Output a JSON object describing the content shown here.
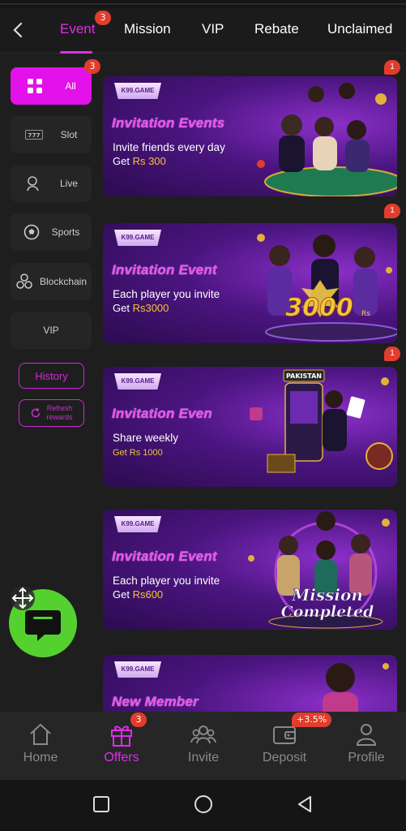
{
  "topnav": {
    "tabs": [
      {
        "label": "Event",
        "badge": "3"
      },
      {
        "label": "Mission"
      },
      {
        "label": "VIP"
      },
      {
        "label": "Rebate"
      },
      {
        "label": "Unclaimed"
      }
    ]
  },
  "sidebar": {
    "items": [
      {
        "label": "All",
        "icon": "grid-icon",
        "badge": "3"
      },
      {
        "label": "Slot",
        "icon": "slot-777-icon"
      },
      {
        "label": "Live",
        "icon": "live-dealer-icon"
      },
      {
        "label": "Sports",
        "icon": "soccer-ball-icon"
      },
      {
        "label": "Blockchain",
        "icon": "blockchain-icon"
      },
      {
        "label": "VIP"
      }
    ],
    "history_label": "History",
    "refresh_label_1": "Refresh",
    "refresh_label_2": "rewards"
  },
  "cards": [
    {
      "brand": "K99.GAME",
      "title": "Invitation Events",
      "line1": "Invite friends every day",
      "line2_prefix": "Get ",
      "line2_amount": "Rs 300",
      "badge": "1"
    },
    {
      "brand": "K99.GAME",
      "title": "Invitation Event",
      "line1": "Each player you invite",
      "line2_prefix": "Get ",
      "line2_amount": "Rs3000",
      "badge": "1",
      "art_text": "3000",
      "art_sub": "Rs"
    },
    {
      "brand": "K99.GAME",
      "title": "Invitation Even",
      "line1": "Share weekly",
      "line2_prefix": "",
      "line2_amount": "Get Rs 1000",
      "badge": "1",
      "art_text": "PAKISTAN"
    },
    {
      "brand": "K99.GAME",
      "title": "Invitation Event",
      "line1": "Each player you invite",
      "line2_prefix": "Get ",
      "line2_amount": "Rs600",
      "art_text": "Mission",
      "art_sub": "Completed"
    },
    {
      "brand": "K99.GAME",
      "title": "New Member"
    }
  ],
  "bottomnav": {
    "items": [
      {
        "label": "Home",
        "icon": "home-icon"
      },
      {
        "label": "Offers",
        "icon": "gift-icon",
        "badge": "3"
      },
      {
        "label": "Invite",
        "icon": "invite-users-icon"
      },
      {
        "label": "Deposit",
        "icon": "wallet-icon",
        "badge": "+3.5%"
      },
      {
        "label": "Profile",
        "icon": "profile-icon"
      }
    ]
  },
  "colors": {
    "accent": "#e12ce8",
    "badge": "#e23d2c",
    "chat": "#55d12f",
    "amount": "#f3c23a"
  }
}
